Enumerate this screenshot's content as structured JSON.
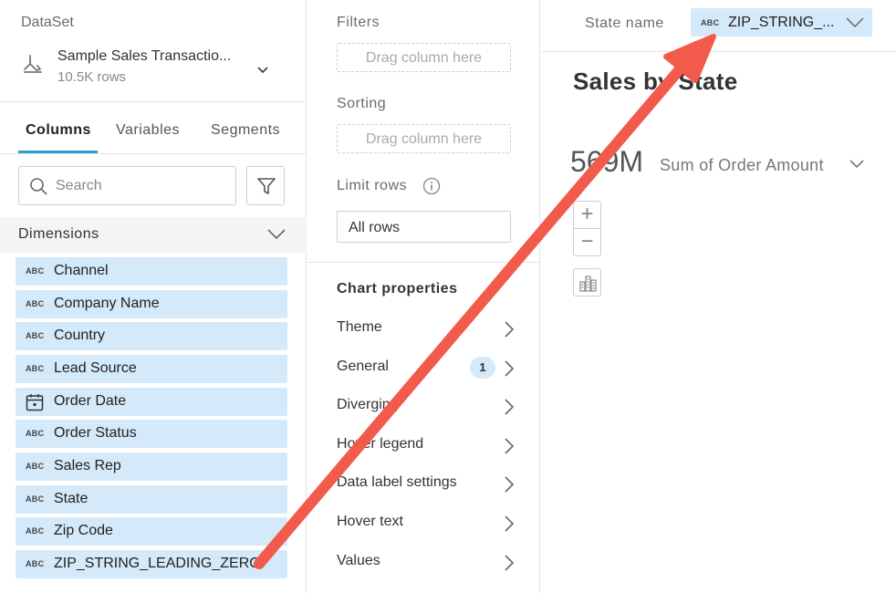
{
  "dataset": {
    "label": "DataSet",
    "name": "Sample Sales Transactio...",
    "rows": "10.5K rows",
    "icon": "dataset-icon"
  },
  "tabs": [
    "Columns",
    "Variables",
    "Segments"
  ],
  "search": {
    "placeholder": "Search"
  },
  "dimensions": {
    "title": "Dimensions",
    "items": [
      {
        "type": "ABC",
        "label": "Channel"
      },
      {
        "type": "ABC",
        "label": "Company Name"
      },
      {
        "type": "ABC",
        "label": "Country"
      },
      {
        "type": "ABC",
        "label": "Lead Source"
      },
      {
        "type": "date",
        "label": "Order Date"
      },
      {
        "type": "ABC",
        "label": "Order Status"
      },
      {
        "type": "ABC",
        "label": "Sales Rep"
      },
      {
        "type": "ABC",
        "label": "State"
      },
      {
        "type": "ABC",
        "label": "Zip Code"
      },
      {
        "type": "ABC",
        "label": "ZIP_STRING_LEADING_ZERO"
      }
    ]
  },
  "middle": {
    "filters_label": "Filters",
    "filters_drop": "Drag column here",
    "sorting_label": "Sorting",
    "sorting_drop": "Drag column here",
    "limit_label": "Limit rows",
    "limit_value": "All rows",
    "chart_properties_title": "Chart properties",
    "properties": [
      {
        "label": "Theme",
        "badge": ""
      },
      {
        "label": "General",
        "badge": "1"
      },
      {
        "label": "Diverging",
        "badge": ""
      },
      {
        "label": "Hover legend",
        "badge": ""
      },
      {
        "label": "Data label settings",
        "badge": ""
      },
      {
        "label": "Hover text",
        "badge": ""
      },
      {
        "label": "Values",
        "badge": ""
      }
    ]
  },
  "right": {
    "state_label": "State name",
    "state_type": "ABC",
    "state_value": "ZIP_STRING_...",
    "chart_title": "Sales by State",
    "metric_value": "569M",
    "metric_label": "Sum of Order Amount",
    "zoom_in": "+",
    "zoom_out": "−"
  },
  "colors": {
    "accent": "#2d9bd4",
    "field_bg": "#d4e9fa",
    "arrow": "#f25a4b"
  }
}
